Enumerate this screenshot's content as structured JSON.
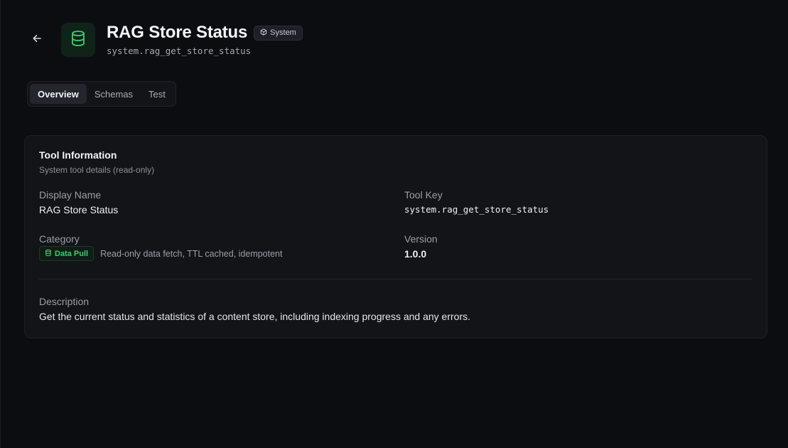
{
  "header": {
    "back_icon": "arrow-left-icon",
    "tool_icon": "database-icon",
    "title": "RAG Store Status",
    "badge": {
      "icon": "box-icon",
      "label": "System"
    },
    "tool_key": "system.rag_get_store_status"
  },
  "tabs": [
    {
      "label": "Overview",
      "active": true
    },
    {
      "label": "Schemas",
      "active": false
    },
    {
      "label": "Test",
      "active": false
    }
  ],
  "card": {
    "title": "Tool Information",
    "subtitle": "System tool details (read-only)",
    "display_name": {
      "label": "Display Name",
      "value": "RAG Store Status"
    },
    "tool_key": {
      "label": "Tool Key",
      "value": "system.rag_get_store_status"
    },
    "category": {
      "label": "Category",
      "badge_icon": "database-icon",
      "badge_label": "Data Pull",
      "badge_color": "#3ecf6d",
      "description": "Read-only data fetch, TTL cached, idempotent"
    },
    "version": {
      "label": "Version",
      "value": "1.0.0"
    },
    "description": {
      "label": "Description",
      "value": "Get the current status and statistics of a content store, including indexing progress and any errors."
    }
  },
  "colors": {
    "background": "#0c0d10",
    "card": "#121418",
    "accent_green": "#3ecf6d"
  }
}
